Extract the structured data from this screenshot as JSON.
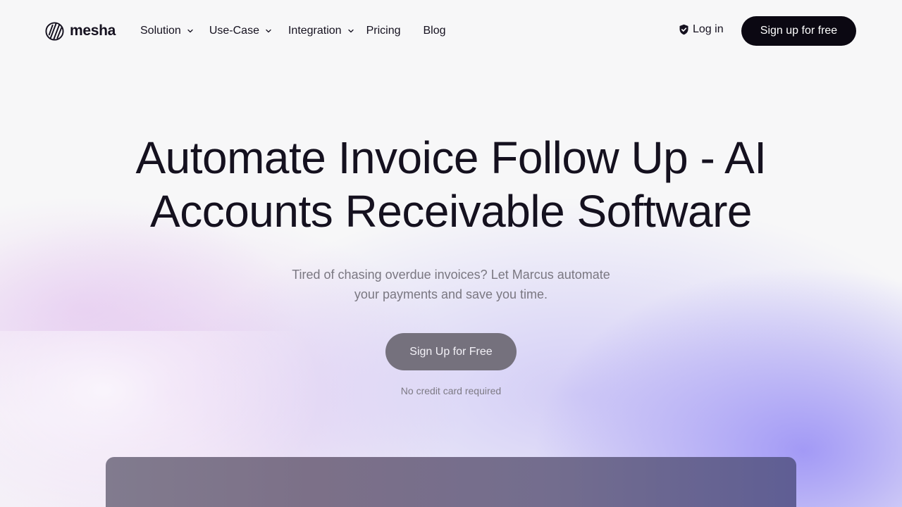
{
  "brand": {
    "name": "mesha",
    "icon": "mesha-logo-icon"
  },
  "nav": {
    "items": [
      {
        "label": "Solution",
        "has_dropdown": true
      },
      {
        "label": "Use-Case",
        "has_dropdown": true
      },
      {
        "label": "Integration",
        "has_dropdown": true
      },
      {
        "label": "Pricing",
        "has_dropdown": false
      },
      {
        "label": "Blog",
        "has_dropdown": false
      }
    ],
    "login_label": "Log in",
    "login_icon": "shield-check-icon",
    "signup_label": "Sign up for free"
  },
  "hero": {
    "title_line1": "Automate Invoice Follow Up - AI",
    "title_line2": "Accounts Receivable Software",
    "subtitle_line1": "Tired of chasing overdue invoices? Let Marcus automate",
    "subtitle_line2": "your payments and save you time.",
    "cta_label": "Sign Up for Free",
    "cta_note": "No credit card required"
  },
  "colors": {
    "text": "#15111f",
    "primary_button": "#0b0812",
    "cta_button": "#75717d",
    "glow_purple": "#968cf5",
    "glow_pink": "#e1c3f0"
  }
}
